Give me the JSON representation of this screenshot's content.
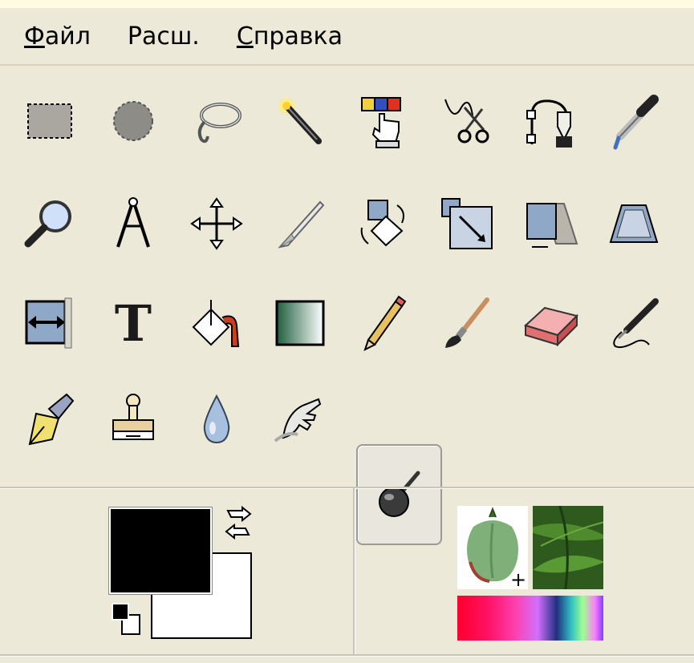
{
  "menubar": {
    "items": [
      {
        "mnemonic": "Ф",
        "rest": "айл"
      },
      {
        "mnemonic": "",
        "rest": "Расш."
      },
      {
        "mnemonic": "С",
        "rest": "правка"
      }
    ]
  },
  "tools": [
    {
      "name": "rect-select-icon"
    },
    {
      "name": "ellipse-select-icon"
    },
    {
      "name": "free-select-icon"
    },
    {
      "name": "fuzzy-select-icon"
    },
    {
      "name": "select-by-color-icon"
    },
    {
      "name": "scissors-select-icon"
    },
    {
      "name": "paths-icon"
    },
    {
      "name": "color-picker-icon"
    },
    {
      "name": "zoom-icon"
    },
    {
      "name": "measure-icon"
    },
    {
      "name": "move-icon"
    },
    {
      "name": "crop-icon"
    },
    {
      "name": "rotate-icon"
    },
    {
      "name": "scale-icon"
    },
    {
      "name": "shear-icon"
    },
    {
      "name": "perspective-icon"
    },
    {
      "name": "flip-icon"
    },
    {
      "name": "text-icon"
    },
    {
      "name": "bucket-fill-icon"
    },
    {
      "name": "blend-icon"
    },
    {
      "name": "pencil-icon"
    },
    {
      "name": "paintbrush-icon"
    },
    {
      "name": "eraser-icon"
    },
    {
      "name": "airbrush-icon"
    },
    {
      "name": "ink-icon"
    },
    {
      "name": "clone-icon"
    },
    {
      "name": "blur-sharpen-icon"
    },
    {
      "name": "smudge-icon"
    },
    {
      "name": "dodge-burn-icon",
      "active": true
    }
  ],
  "text_tool_glyph": "T",
  "colors": {
    "foreground": "#000000",
    "background": "#ffffff"
  }
}
